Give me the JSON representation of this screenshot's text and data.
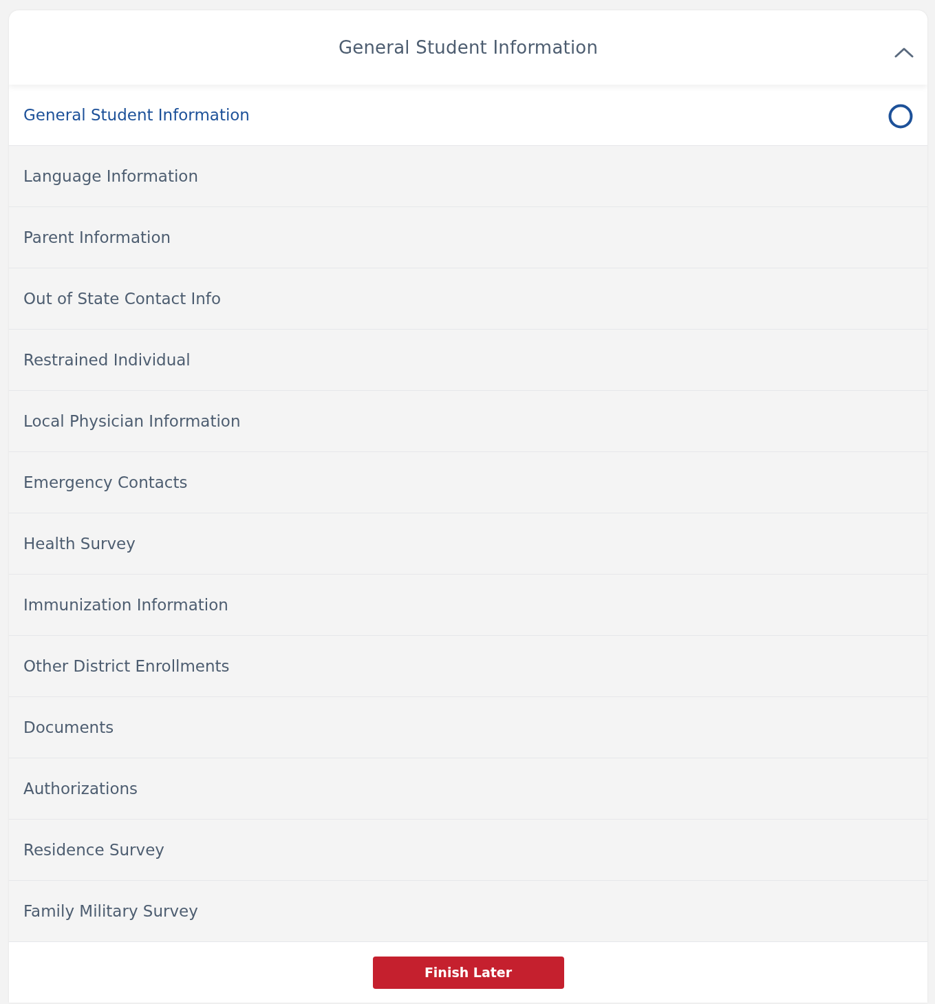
{
  "header": {
    "title": "General Student Information",
    "expanded": true
  },
  "sections": [
    {
      "label": "General Student Information",
      "selected": true
    },
    {
      "label": "Language Information",
      "selected": false
    },
    {
      "label": "Parent Information",
      "selected": false
    },
    {
      "label": "Out of State Contact Info",
      "selected": false
    },
    {
      "label": "Restrained Individual",
      "selected": false
    },
    {
      "label": "Local Physician Information",
      "selected": false
    },
    {
      "label": "Emergency Contacts",
      "selected": false
    },
    {
      "label": "Health Survey",
      "selected": false
    },
    {
      "label": "Immunization Information",
      "selected": false
    },
    {
      "label": "Other District Enrollments",
      "selected": false
    },
    {
      "label": "Documents",
      "selected": false
    },
    {
      "label": "Authorizations",
      "selected": false
    },
    {
      "label": "Residence Survey",
      "selected": false
    },
    {
      "label": "Family Military Survey",
      "selected": false
    }
  ],
  "footer": {
    "button": "Finish Later"
  }
}
